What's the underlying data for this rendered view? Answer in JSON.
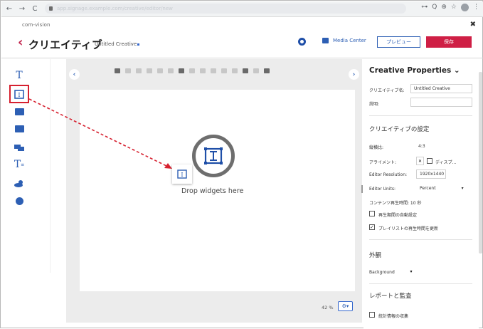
{
  "browser": {
    "nav_back": "←",
    "nav_forward": "→",
    "nav_reload": "C",
    "url": "app.signage.example.com/creative/editor/new",
    "right_icons": [
      "⊶",
      "Q",
      "⊕",
      "☆",
      "⋮"
    ]
  },
  "app": {
    "brand": "com-vision",
    "close": "✖",
    "back": "‹",
    "title": "クリエイティブ",
    "creative_name": "Untitled Creative",
    "media_center": "Media Center",
    "preview": "プレビュー",
    "save": "保存"
  },
  "canvas": {
    "prev": "‹",
    "next": "›",
    "drop_text": "Drop widgets here",
    "zoom": "42 %",
    "zoom_btn": "⚙▾"
  },
  "panel": {
    "title": "Creative Properties  ⌄",
    "name_label": "クリエイティブ名:",
    "name_value": "Untitled Creative",
    "desc_label": "説明:",
    "settings_title": "クリエイティブの設定",
    "aspect_label": "縦横比:",
    "aspect_value": "4:3",
    "align_label": "アライメント:",
    "align_value": "ディスプ...",
    "align_x": "✕",
    "res_label": "Editor Resolution:",
    "res_value": "1920x1440",
    "units_label": "Editor Units:",
    "units_value": "Percent",
    "duration": "コンテンツ再生時間: 10 秒",
    "cb1": "再生期間の自動設定",
    "cb2": "プレイリストの再生時間を更新",
    "appearance_title": "外観",
    "background_label": "Background",
    "report_title": "レポートと監査",
    "cb3": "統計情報の収集"
  },
  "colors": {
    "accent": "#2d5fb4",
    "save": "#cf1f45",
    "highlight": "#d6202f"
  },
  "icons": {
    "left_tools": [
      "text-icon",
      "ticker-icon",
      "image-icon",
      "video-icon",
      "social-icon",
      "rich-text-icon",
      "weather-icon",
      "clock-icon"
    ]
  }
}
